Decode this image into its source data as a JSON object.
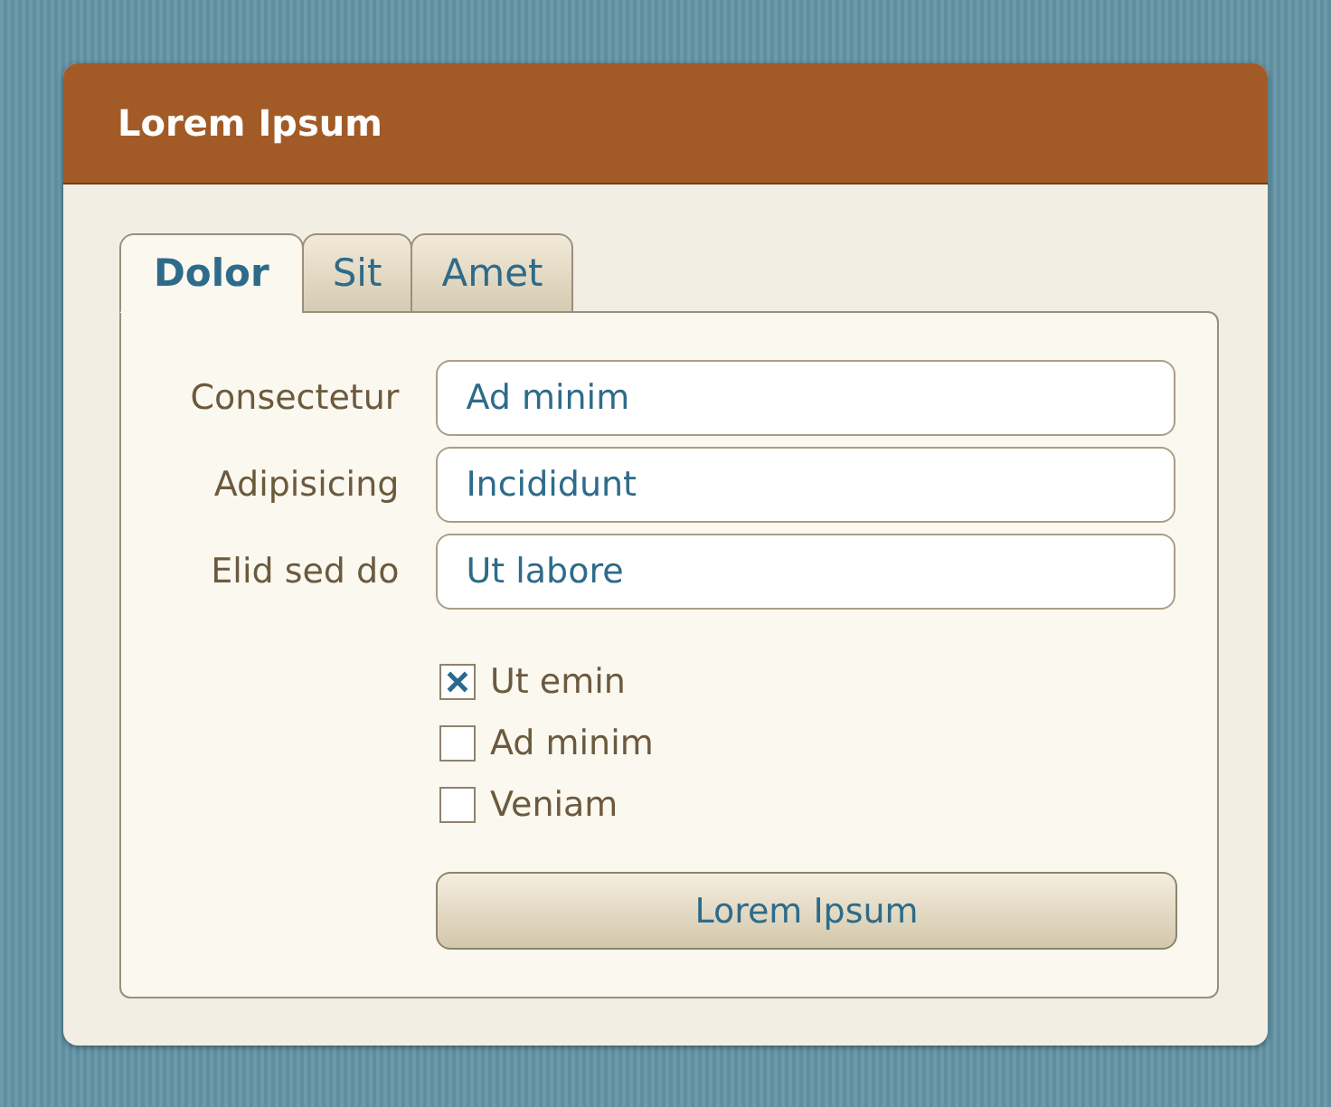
{
  "panel": {
    "title": "Lorem Ipsum"
  },
  "tabs": [
    {
      "label": "Dolor",
      "selected": true
    },
    {
      "label": "Sit",
      "selected": false
    },
    {
      "label": "Amet",
      "selected": false
    }
  ],
  "fields": [
    {
      "label": "Consectetur",
      "value": "Ad minim"
    },
    {
      "label": "Adipisicing",
      "value": "Incididunt"
    },
    {
      "label": "Elid sed do",
      "value": "Ut labore"
    }
  ],
  "checkboxes": [
    {
      "label": "Ut emin",
      "checked": true
    },
    {
      "label": "Ad minim",
      "checked": false
    },
    {
      "label": "Veniam",
      "checked": false
    }
  ],
  "button": "Lorem Ipsum"
}
